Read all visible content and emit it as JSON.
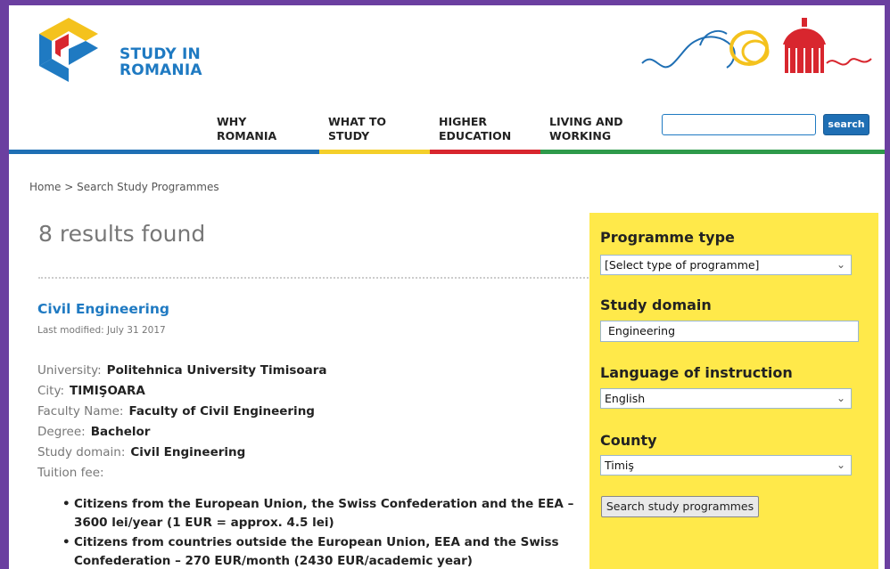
{
  "header": {
    "logo_line1": "STUDY IN",
    "logo_line2": "ROMANIA",
    "nav": [
      {
        "line1": "WHY",
        "line2": "ROMANIA",
        "color": "#1f6fb4"
      },
      {
        "line1": "WHAT TO",
        "line2": "STUDY",
        "color": "#f4cf2a"
      },
      {
        "line1": "HIGHER",
        "line2": "EDUCATION",
        "color": "#d8262e"
      },
      {
        "line1": "LIVING AND",
        "line2": "WORKING",
        "color": "#2e9a4a"
      }
    ],
    "search_value": "",
    "search_label": "search"
  },
  "breadcrumb": "Home > Search Study Programmes",
  "results_title": "8 results found",
  "programme": {
    "title": "Civil Engineering",
    "modified": "Last modified: July 31 2017",
    "fields": [
      {
        "key": "University:",
        "value": "Politehnica University Timisoara"
      },
      {
        "key": "City:",
        "value": "TIMIŞOARA"
      },
      {
        "key": "Faculty Name:",
        "value": "Faculty of Civil Engineering"
      },
      {
        "key": "Degree:",
        "value": "Bachelor"
      },
      {
        "key": "Study domain:",
        "value": "Civil Engineering"
      },
      {
        "key": "Tuition fee:",
        "value": ""
      }
    ],
    "fees": [
      "Citizens from the European Union, the Swiss Confederation and the EEA – 3600 lei/year (1 EUR = approx. 4.5 lei)",
      "Citizens from countries outside the European Union, EEA and the Swiss Confederation – 270 EUR/month (2430 EUR/academic year)"
    ]
  },
  "filters": {
    "programme_type_label": "Programme type",
    "programme_type_value": "[Select type of programme]",
    "study_domain_label": "Study domain",
    "study_domain_value": "Engineering",
    "language_label": "Language of instruction",
    "language_value": "English",
    "county_label": "County",
    "county_value": "Timiş",
    "button": "Search study programmes"
  },
  "colors": {
    "brand_blue": "#1f7ac2",
    "panel_yellow": "#ffe94a",
    "frame_purple": "#6b3fa0"
  }
}
